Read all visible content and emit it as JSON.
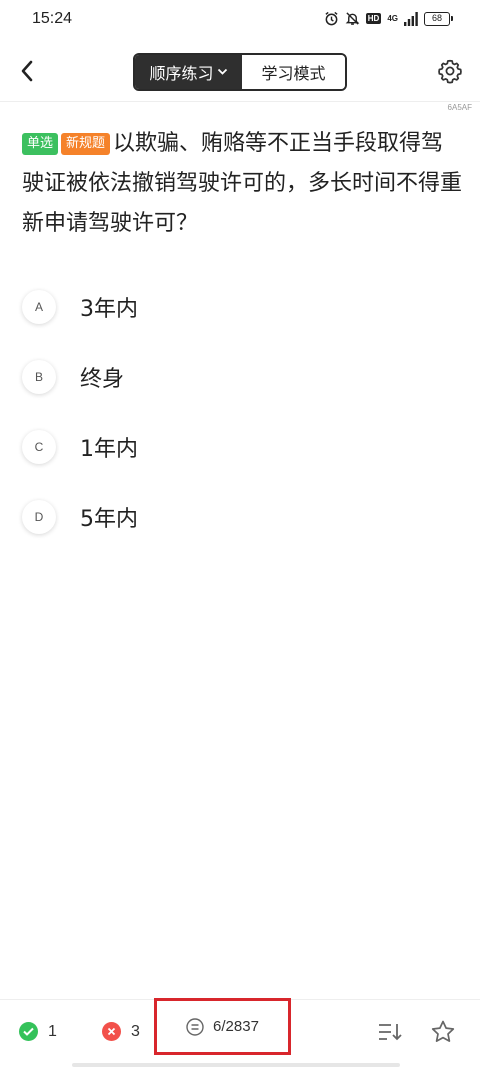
{
  "status_bar": {
    "time": "15:24",
    "network": "4G",
    "hd": "HD",
    "battery": "68",
    "icons": [
      "alarm-icon",
      "mute-bell-icon",
      "hd-icon",
      "signal-icon",
      "battery-icon"
    ]
  },
  "header": {
    "back_icon": "chevron-left-icon",
    "mode_active": "顺序练习",
    "mode_inactive": "学习模式",
    "settings_icon": "gear-icon",
    "question_code": "6A5AF"
  },
  "question": {
    "tag_type": "单选",
    "tag_new": "新规题",
    "text": "以欺骗、贿赂等不正当手段取得驾驶证被依法撤销驾驶许可的，多长时间不得重新申请驾驶许可？"
  },
  "options": [
    {
      "letter": "A",
      "text": "3年内"
    },
    {
      "letter": "B",
      "text": "终身"
    },
    {
      "letter": "C",
      "text": "1年内"
    },
    {
      "letter": "D",
      "text": "5年内"
    }
  ],
  "footer": {
    "correct_count": "1",
    "wrong_count": "3",
    "progress": "6/2837",
    "current_question": 6,
    "total_questions": 2837,
    "accent_highlight": "#d8262c",
    "correct_color": "#34c25a",
    "wrong_color": "#f2504a",
    "icons": [
      "check-icon",
      "cross-icon",
      "list-icon",
      "sort-icon",
      "star-icon"
    ]
  }
}
